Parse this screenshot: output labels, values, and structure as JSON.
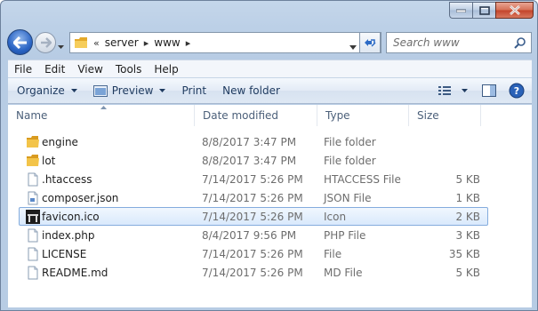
{
  "window": {
    "caption_buttons": [
      "minimize",
      "maximize",
      "close"
    ]
  },
  "navigation": {
    "breadcrumb_overflow": "«",
    "breadcrumbs": [
      "server",
      "www"
    ],
    "search_placeholder": "Search www"
  },
  "menubar": {
    "items": [
      "File",
      "Edit",
      "View",
      "Tools",
      "Help"
    ]
  },
  "toolbar": {
    "organize": "Organize",
    "preview": "Preview",
    "print": "Print",
    "new_folder": "New folder"
  },
  "columns": {
    "name": "Name",
    "date_modified": "Date modified",
    "type": "Type",
    "size": "Size"
  },
  "files": [
    {
      "name": "engine",
      "date": "8/8/2017 3:47 PM",
      "type": "File folder",
      "size": "",
      "icon": "folder-icon"
    },
    {
      "name": "lot",
      "date": "8/8/2017 3:47 PM",
      "type": "File folder",
      "size": "",
      "icon": "folder-icon"
    },
    {
      "name": ".htaccess",
      "date": "7/14/2017 5:26 PM",
      "type": "HTACCESS File",
      "size": "5 KB",
      "icon": "document-icon"
    },
    {
      "name": "composer.json",
      "date": "7/14/2017 5:26 PM",
      "type": "JSON File",
      "size": "1 KB",
      "icon": "document-icon"
    },
    {
      "name": "favicon.ico",
      "date": "7/14/2017 5:26 PM",
      "type": "Icon",
      "size": "2 KB",
      "icon": "favicon-image-icon",
      "selected": true
    },
    {
      "name": "index.php",
      "date": "8/4/2017 9:56 PM",
      "type": "PHP File",
      "size": "3 KB",
      "icon": "document-icon"
    },
    {
      "name": "LICENSE",
      "date": "7/14/2017 5:26 PM",
      "type": "File",
      "size": "35 KB",
      "icon": "document-icon"
    },
    {
      "name": "README.md",
      "date": "7/14/2017 5:26 PM",
      "type": "MD File",
      "size": "5 KB",
      "icon": "document-icon"
    }
  ],
  "colors": {
    "chrome": "#bcd0e7",
    "selection": "#d9e9fc",
    "selection_border": "#84acdd",
    "folder": "#e9b53d",
    "back_button": "#2a64c4"
  }
}
